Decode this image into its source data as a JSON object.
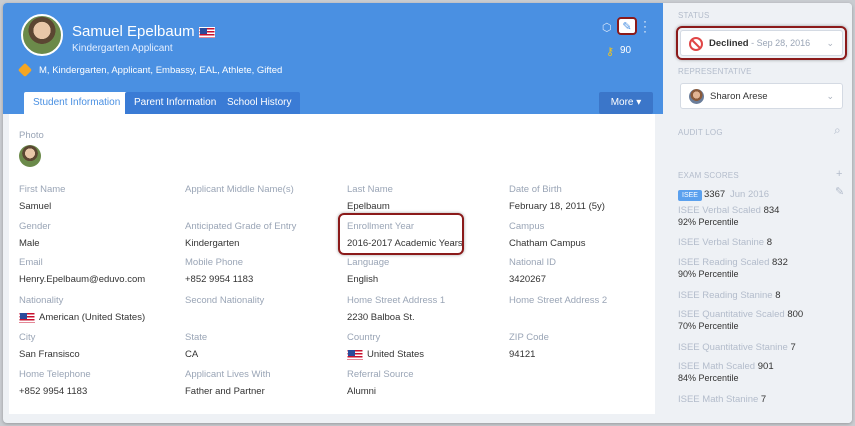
{
  "student": {
    "name": "Samuel Epelbaum",
    "role": "Kindergarten Applicant",
    "tags": "M, Kindergarten, Applicant, Embassy, EAL, Athlete, Gifted",
    "score": "90"
  },
  "tabs": [
    "Student Information",
    "Parent Information",
    "School History"
  ],
  "more_label": "More",
  "photo_label": "Photo",
  "fields": [
    {
      "label": "First Name",
      "value": "Samuel"
    },
    {
      "label": "Applicant Middle Name(s)",
      "value": ""
    },
    {
      "label": "Last Name",
      "value": "Epelbaum"
    },
    {
      "label": "Date of Birth",
      "value": "February 18, 2011 (5y)"
    },
    {
      "label": "Gender",
      "value": "Male"
    },
    {
      "label": "Anticipated Grade of Entry",
      "value": "Kindergarten"
    },
    {
      "label": "Enrollment Year",
      "value": "2016-2017 Academic Years"
    },
    {
      "label": "Campus",
      "value": "Chatham Campus"
    },
    {
      "label": "Email",
      "value": "Henry.Epelbaum@eduvo.com"
    },
    {
      "label": "Mobile Phone",
      "value": "+852 9954 1183"
    },
    {
      "label": "Language",
      "value": "English"
    },
    {
      "label": "National ID",
      "value": "3420267"
    },
    {
      "label": "Nationality",
      "value": "American (United States)"
    },
    {
      "label": "Second Nationality",
      "value": ""
    },
    {
      "label": "Home Street Address 1",
      "value": "2230 Balboa St."
    },
    {
      "label": "Home Street Address 2",
      "value": ""
    },
    {
      "label": "City",
      "value": "San Fransisco"
    },
    {
      "label": "State",
      "value": "CA"
    },
    {
      "label": "Country",
      "value": "United States"
    },
    {
      "label": "ZIP Code",
      "value": "94121"
    },
    {
      "label": "Home Telephone",
      "value": "+852 9954 1183"
    },
    {
      "label": "Applicant Lives With",
      "value": "Father and Partner"
    },
    {
      "label": "Referral Source",
      "value": "Alumni"
    }
  ],
  "sidebar": {
    "status_label": "STATUS",
    "status_value": "Declined",
    "status_date": " - Sep 28, 2016",
    "representative_label": "REPRESENTATIVE",
    "representative_value": "Sharon Arese",
    "audit_label": "AUDIT LOG",
    "exam_label": "EXAM SCORES",
    "isee_badge": "ISEE",
    "isee_total": "3367",
    "isee_date": "Jun 2016",
    "scores": [
      {
        "label": "ISEE Verbal Scaled",
        "value": "834",
        "sub": "92% Percentile"
      },
      {
        "label": "ISEE Verbal Stanine",
        "value": "8",
        "sub": ""
      },
      {
        "label": "ISEE Reading Scaled",
        "value": "832",
        "sub": "90% Percentile"
      },
      {
        "label": "ISEE Reading Stanine",
        "value": "8",
        "sub": ""
      },
      {
        "label": "ISEE Quantitative Scaled",
        "value": "800",
        "sub": "70% Percentile"
      },
      {
        "label": "ISEE Quantitative Stanine",
        "value": "7",
        "sub": ""
      },
      {
        "label": "ISEE Math Scaled",
        "value": "901",
        "sub": "84% Percentile"
      },
      {
        "label": "ISEE Math Stanine",
        "value": "7",
        "sub": ""
      }
    ]
  },
  "colors": {
    "header": "#4a90e2",
    "highlight": "#8b1a1a",
    "declined": "#e04646"
  }
}
